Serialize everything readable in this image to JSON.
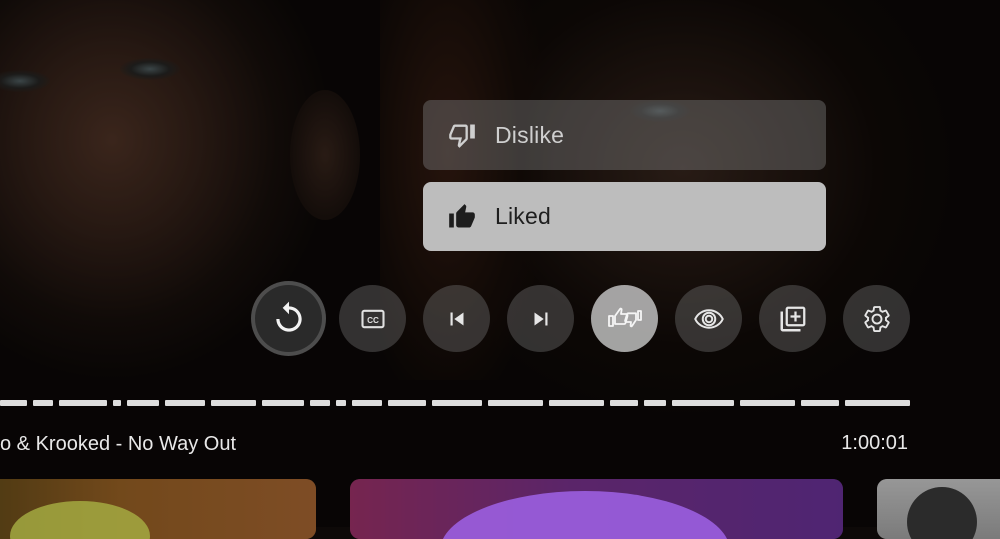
{
  "rating_menu": {
    "dislike_label": "Dislike",
    "liked_label": "Liked"
  },
  "controls": [
    {
      "name": "repeat-button",
      "icon": "repeat-icon"
    },
    {
      "name": "captions-button",
      "icon": "cc-icon"
    },
    {
      "name": "previous-button",
      "icon": "skip-previous-icon"
    },
    {
      "name": "next-button",
      "icon": "skip-next-icon"
    },
    {
      "name": "rate-button",
      "icon": "thumbs-up-down-icon",
      "focused": true
    },
    {
      "name": "ambient-mode-button",
      "icon": "eye-icon"
    },
    {
      "name": "add-to-playlist-button",
      "icon": "playlist-add-icon"
    },
    {
      "name": "settings-button",
      "icon": "gear-icon"
    }
  ],
  "now_playing": {
    "title": "o & Krooked - No Way Out",
    "duration": "1:00:01"
  },
  "colors": {
    "liked_bg": "#bdbdbd",
    "dislike_bg": "#787878",
    "progress": "#dedede"
  }
}
